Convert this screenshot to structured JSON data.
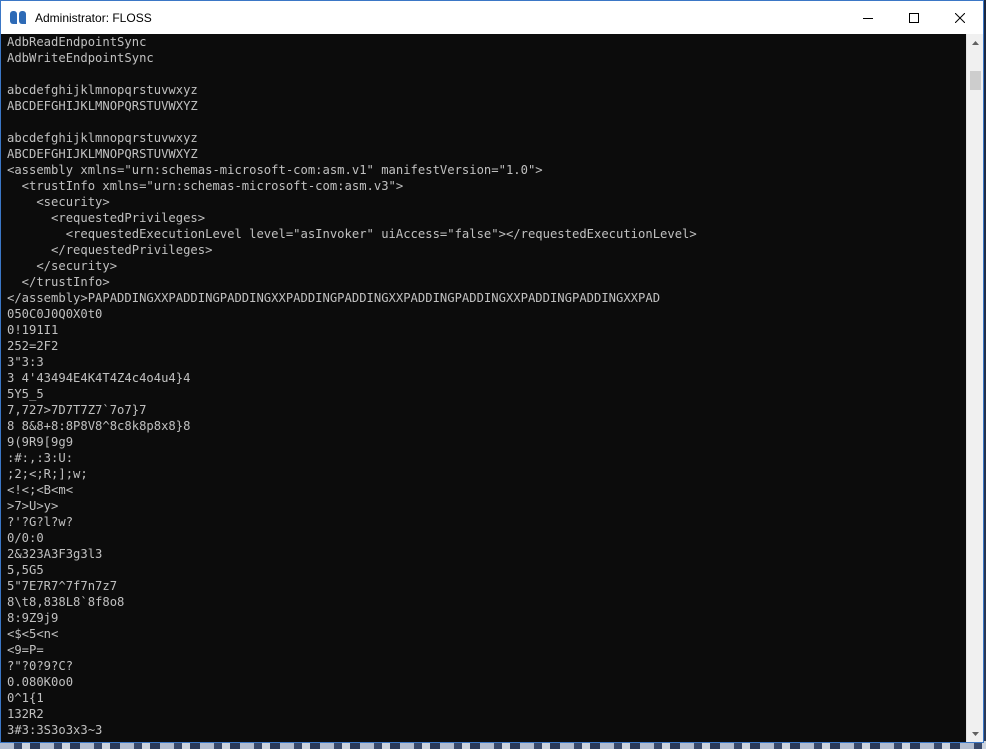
{
  "window": {
    "title": "Administrator: FLOSS",
    "icon": "floss-app-icon",
    "controls": [
      "minimize-icon",
      "maximize-icon",
      "close-icon"
    ]
  },
  "scrollbar": {
    "position": 0.04
  },
  "console": {
    "lines": [
      "AdbReadEndpointSync",
      "AdbWriteEndpointSync",
      "",
      "abcdefghijklmnopqrstuvwxyz",
      "ABCDEFGHIJKLMNOPQRSTUVWXYZ",
      "",
      "abcdefghijklmnopqrstuvwxyz",
      "ABCDEFGHIJKLMNOPQRSTUVWXYZ",
      "<assembly xmlns=\"urn:schemas-microsoft-com:asm.v1\" manifestVersion=\"1.0\">",
      "  <trustInfo xmlns=\"urn:schemas-microsoft-com:asm.v3\">",
      "    <security>",
      "      <requestedPrivileges>",
      "        <requestedExecutionLevel level=\"asInvoker\" uiAccess=\"false\"></requestedExecutionLevel>",
      "      </requestedPrivileges>",
      "    </security>",
      "  </trustInfo>",
      "</assembly>PAPADDINGXXPADDINGPADDINGXXPADDINGPADDINGXXPADDINGPADDINGXXPADDINGPADDINGXXPAD",
      "050C0J0Q0X0t0",
      "0!191I1",
      "252=2F2",
      "3\"3:3",
      "3 4'43494E4K4T4Z4c4o4u4}4",
      "5Y5_5",
      "7,727>7D7T7Z7`7o7}7",
      "8 8&8+8:8P8V8^8c8k8p8x8}8",
      "9(9R9[9g9",
      ":#:,:3:U:",
      ";2;<;R;];w;",
      "<!<;<B<m<",
      ">7>U>y>",
      "?'?G?l?w?",
      "0/0:0",
      "2&323A3F3g3l3",
      "5,5G5",
      "5\"7E7R7^7f7n7z7",
      "8\\t8,838L8`8f8o8",
      "8:9Z9j9",
      "<$<5<n<",
      "<9=P=",
      "?\"?0?9?C?",
      "0.080K0o0",
      "0^1{1",
      "132R2",
      "3#3:3S3o3x3~3"
    ]
  }
}
